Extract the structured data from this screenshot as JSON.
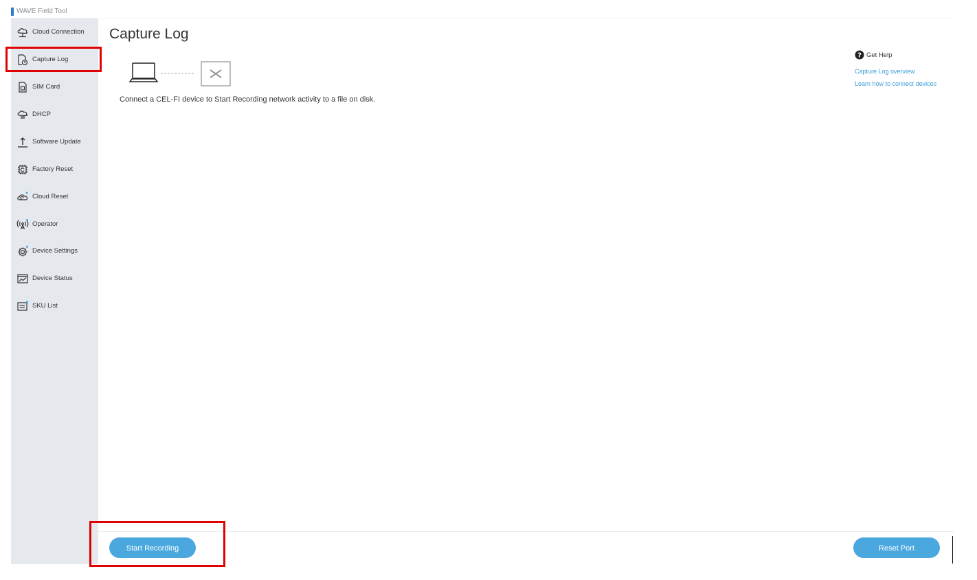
{
  "app": {
    "title": "WAVE Field Tool"
  },
  "sidebar": {
    "items": [
      {
        "label": "Cloud Connection",
        "icon": "cloud-connection-icon"
      },
      {
        "label": "Capture Log",
        "icon": "capture-log-icon",
        "selected": true
      },
      {
        "label": "SIM Card",
        "icon": "sim-card-icon"
      },
      {
        "label": "DHCP",
        "icon": "dhcp-icon"
      },
      {
        "label": "Software Update",
        "icon": "upload-icon"
      },
      {
        "label": "Factory Reset",
        "icon": "chip-reset-icon"
      },
      {
        "label": "Cloud Reset",
        "icon": "cloud-reset-icon"
      },
      {
        "label": "Operator",
        "icon": "antenna-icon"
      },
      {
        "label": "Device Settings",
        "icon": "gear-icon"
      },
      {
        "label": "Device Status",
        "icon": "chart-icon"
      },
      {
        "label": "SKU List",
        "icon": "list-icon"
      }
    ]
  },
  "main": {
    "title": "Capture Log",
    "message": "Connect a CEL-FI device to Start Recording network activity to a file on disk."
  },
  "help": {
    "title": "Get Help",
    "links": [
      "Capture Log overview",
      "Learn how to connect devices"
    ]
  },
  "footer": {
    "start_label": "Start Recording",
    "reset_label": "Reset Port"
  },
  "colors": {
    "accent": "#4aa8df",
    "link": "#3a9ad9",
    "sidebar_bg": "#e5e9ed",
    "highlight": "#e00000"
  }
}
